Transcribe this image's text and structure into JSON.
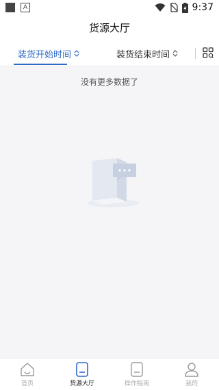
{
  "status_bar": {
    "time": "9:37"
  },
  "header": {
    "title": "货源大厅"
  },
  "filters": [
    {
      "label": "装货开始时间",
      "active": true
    },
    {
      "label": "装货结束时间",
      "active": false
    }
  ],
  "content": {
    "empty_message": "没有更多数据了"
  },
  "tabs": [
    {
      "label": "首页",
      "icon": "home-icon",
      "active": false
    },
    {
      "label": "货源大厅",
      "icon": "cargo-hall-icon",
      "active": true
    },
    {
      "label": "操作指南",
      "icon": "guide-icon",
      "active": false
    },
    {
      "label": "我的",
      "icon": "user-icon",
      "active": false
    }
  ],
  "colors": {
    "accent": "#2e6bc6",
    "background": "#f5f5f7"
  }
}
